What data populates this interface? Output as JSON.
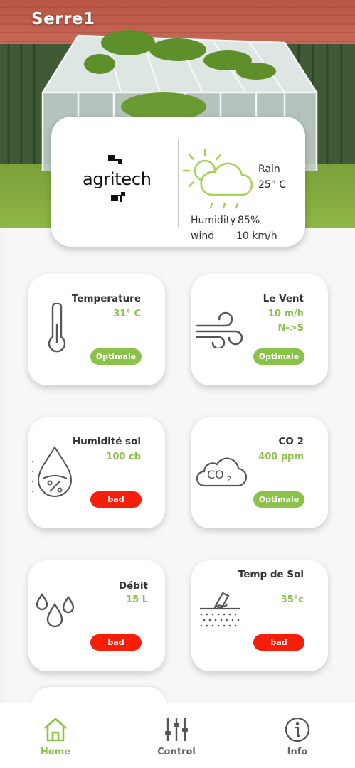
{
  "header": {
    "title": "Serre1"
  },
  "weather": {
    "brand": "agritech",
    "condition": "Rain",
    "temperature": "25° C",
    "humidity_label": "Humidity",
    "humidity_value": "85%",
    "wind_label": "wind",
    "wind_value": "10 km/h"
  },
  "sensors": [
    {
      "title": "Temperature",
      "value": "31° C",
      "status": "Optimale",
      "icon": "thermometer-icon"
    },
    {
      "title": "Le Vent",
      "value": "10 m/h",
      "value2": "N->S",
      "status": "Optimale",
      "icon": "wind-icon"
    },
    {
      "title": "Humidité sol",
      "value": "100 cb",
      "status": "bad",
      "icon": "water-drop-percent-icon"
    },
    {
      "title": "CO 2",
      "value": "400 ppm",
      "status": "Optimale",
      "icon": "co2-cloud-icon"
    },
    {
      "title": "Débit",
      "value": "15 L",
      "status": "bad",
      "icon": "water-drops-icon"
    },
    {
      "title": "Temp de Sol",
      "value": "35°c",
      "status": "bad",
      "icon": "soil-temperature-icon"
    }
  ],
  "nav": [
    {
      "label": "Home",
      "icon": "home-icon",
      "active": true
    },
    {
      "label": "Control",
      "icon": "sliders-icon",
      "active": false
    },
    {
      "label": "Info",
      "icon": "info-icon",
      "active": false
    }
  ],
  "colors": {
    "accent": "#8bc34a",
    "bad": "#f51e0a",
    "text": "#333333"
  }
}
